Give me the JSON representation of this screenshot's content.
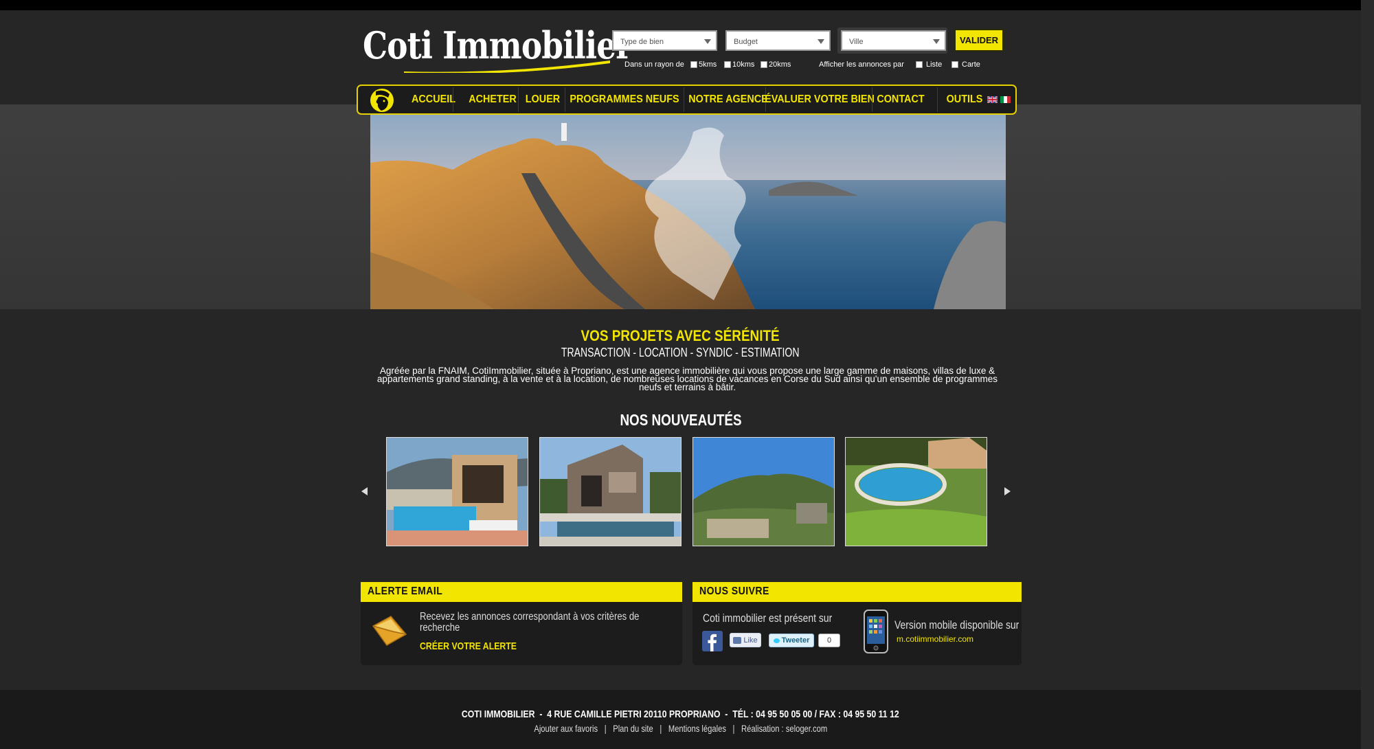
{
  "brand": {
    "name": "Coti Immobilier"
  },
  "search": {
    "type_placeholder": "Type de bien",
    "budget_placeholder": "Budget",
    "ville_placeholder": "Ville",
    "submit": "VALIDER",
    "radius_label": "Dans un rayon de",
    "radius_options": [
      "5kms",
      "10kms",
      "20kms"
    ],
    "display_label": "Afficher les annonces par",
    "display_options": [
      "Liste",
      "Carte"
    ]
  },
  "nav": {
    "items": [
      "ACCUEIL",
      "ACHETER",
      "LOUER",
      "PROGRAMMES NEUFS",
      "NOTRE AGENCE",
      "ÉVALUER VOTRE BIEN",
      "CONTACT",
      "OUTILS"
    ],
    "flags": [
      "uk-flag-icon",
      "italy-flag-icon"
    ]
  },
  "intro": {
    "title": "VOS PROJETS AVEC SÉRÉNITÉ",
    "subtitle": "TRANSACTION - LOCATION - SYNDIC - ESTIMATION",
    "text": "Agréée par la FNAIM, CotiImmobilier, située à Propriano, est une agence immobilière qui vous propose une large gamme de maisons, villas de luxe & appartements grand standing, à la vente et à la location, de nombreuses locations de vacances en Corse du Sud ainsi qu'un ensemble de programmes neufs et terrains à bâtir."
  },
  "nouveautes": {
    "title": "NOS NOUVEAUTÉS"
  },
  "alert": {
    "head": "ALERTE EMAIL",
    "text": "Recevez les annonces correspondant à vos critères de recherche",
    "link": "CRÉER VOTRE ALERTE"
  },
  "follow": {
    "head": "NOUS SUIVRE",
    "text": "Coti immobilier est présent sur",
    "like": "Like",
    "tweet": "Tweeter",
    "tweet_count": "0",
    "mobile_text": "Version mobile disponible sur",
    "mobile_url": "m.cotiimmobilier.com"
  },
  "footer": {
    "address": "COTI IMMOBILIER  -  4 RUE CAMILLE PIETRI 20110 PROPRIANO  -  TÉL : 04 95 50 05 00 / FAX : 04 95 50 11 12",
    "links": [
      "Ajouter aux favoris",
      "Plan du site",
      "Mentions légales",
      "Réalisation : seloger.com"
    ]
  },
  "colors": {
    "accent": "#f2e500",
    "background": "#262626"
  }
}
